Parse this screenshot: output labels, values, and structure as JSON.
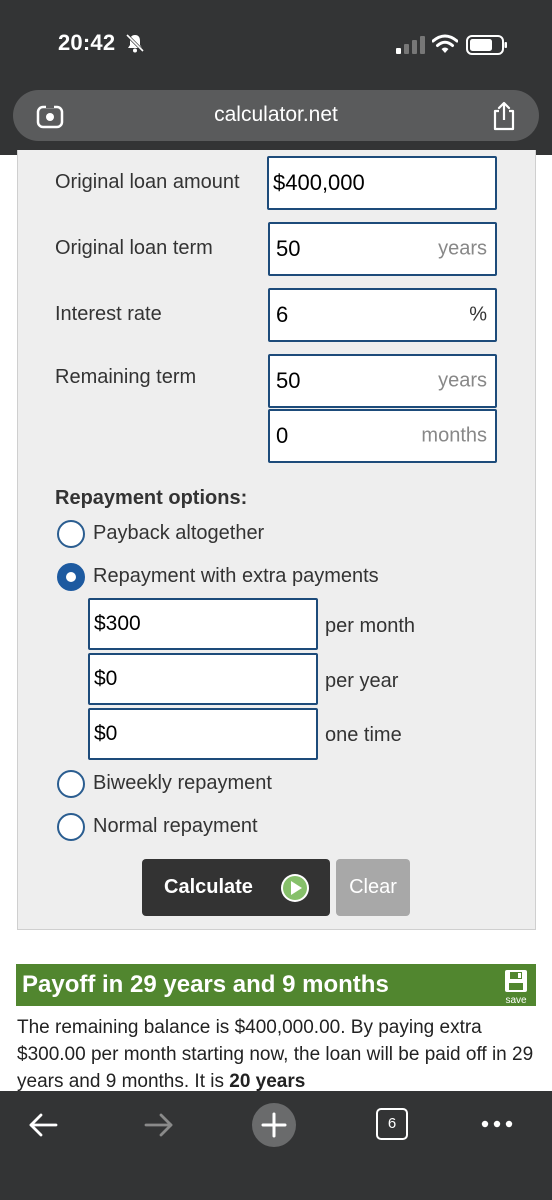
{
  "status": {
    "time": "20:42"
  },
  "browser": {
    "url": "calculator.net",
    "tab_count": "6"
  },
  "form": {
    "original_amount_label": "Original loan amount",
    "original_amount_value": "$400,000",
    "original_term_label": "Original loan term",
    "original_term_value": "50",
    "original_term_unit": "years",
    "interest_label": "Interest rate",
    "interest_value": "6",
    "interest_unit": "%",
    "remaining_label": "Remaining term",
    "remaining_years_value": "50",
    "remaining_years_unit": "years",
    "remaining_months_value": "0",
    "remaining_months_unit": "months"
  },
  "repayment": {
    "title": "Repayment options:",
    "options": [
      {
        "label": "Payback altogether",
        "checked": false
      },
      {
        "label": "Repayment with extra payments",
        "checked": true
      },
      {
        "label": "Biweekly repayment",
        "checked": false
      },
      {
        "label": "Normal repayment",
        "checked": false
      }
    ],
    "extras": [
      {
        "value": "$300",
        "label": "per month"
      },
      {
        "value": "$0",
        "label": "per year"
      },
      {
        "value": "$0",
        "label": "one time"
      }
    ]
  },
  "buttons": {
    "calculate": "Calculate",
    "clear": "Clear"
  },
  "result": {
    "title": "Payoff in 29 years and 9 months",
    "save_label": "save",
    "text": "The remaining balance is $400,000.00. By paying extra $300.00 per month starting now, the loan will be paid off in 29 years and 9 months. It is ",
    "text_bold": "20 years"
  },
  "colors": {
    "accent": "#1d5aa0",
    "result_green": "#51862f",
    "chrome": "#333435"
  }
}
